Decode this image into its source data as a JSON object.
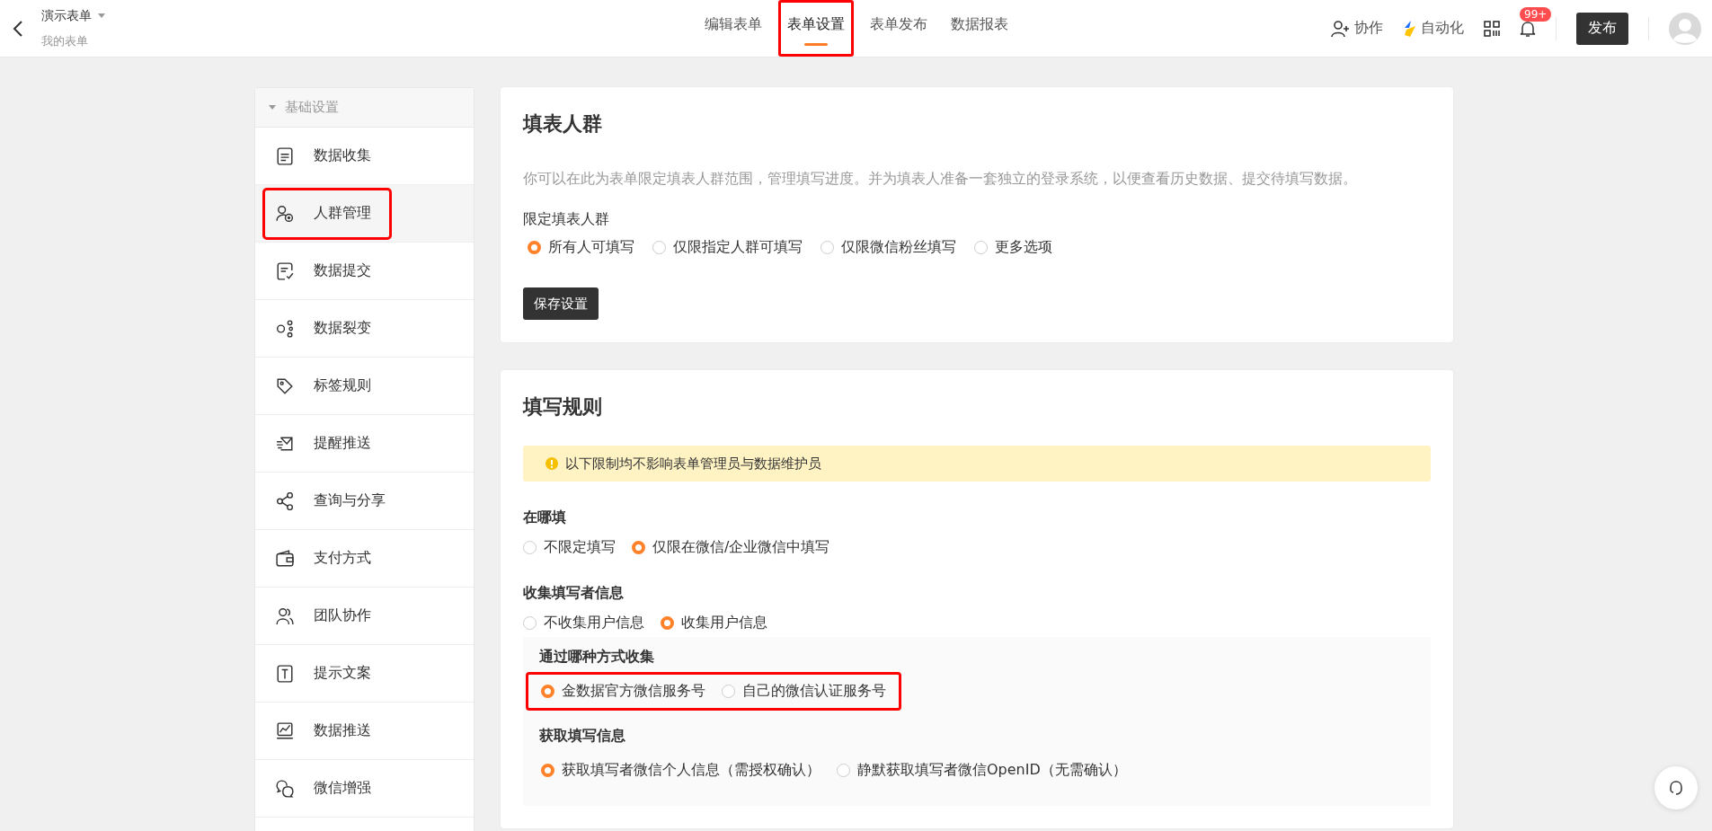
{
  "header": {
    "title": "演示表单",
    "subtitle": "我的表单",
    "tabs": [
      {
        "label": "编辑表单",
        "selected": false,
        "highlighted": false
      },
      {
        "label": "表单设置",
        "selected": true,
        "highlighted": true
      },
      {
        "label": "表单发布",
        "selected": false,
        "highlighted": false
      },
      {
        "label": "数据报表",
        "selected": false,
        "highlighted": false
      }
    ],
    "collaborate": "协作",
    "automation": "自动化",
    "notification_badge": "99+",
    "publish": "发布"
  },
  "sidebar": {
    "group": {
      "label": "基础设置",
      "expanded": true
    },
    "items": [
      {
        "label": "数据收集",
        "selected": false,
        "highlighted": false
      },
      {
        "label": "人群管理",
        "selected": true,
        "highlighted": true
      },
      {
        "label": "数据提交",
        "selected": false,
        "highlighted": false
      },
      {
        "label": "数据裂变",
        "selected": false,
        "highlighted": false
      },
      {
        "label": "标签规则",
        "selected": false,
        "highlighted": false
      },
      {
        "label": "提醒推送",
        "selected": false,
        "highlighted": false
      },
      {
        "label": "查询与分享",
        "selected": false,
        "highlighted": false
      },
      {
        "label": "支付方式",
        "selected": false,
        "highlighted": false
      },
      {
        "label": "团队协作",
        "selected": false,
        "highlighted": false
      },
      {
        "label": "提示文案",
        "selected": false,
        "highlighted": false
      },
      {
        "label": "数据推送",
        "selected": false,
        "highlighted": false
      },
      {
        "label": "微信增强",
        "selected": false,
        "highlighted": false
      }
    ]
  },
  "audience_card": {
    "title": "填表人群",
    "description": "你可以在此为表单限定填表人群范围，管理填写进度。并为填表人准备一套独立的登录系统，以便查看历史数据、提交待填写数据。",
    "field_label": "限定填表人群",
    "options": [
      {
        "label": "所有人可填写",
        "selected": true
      },
      {
        "label": "仅限指定人群可填写",
        "selected": false
      },
      {
        "label": "仅限微信粉丝填写",
        "selected": false
      },
      {
        "label": "更多选项",
        "selected": false
      }
    ],
    "save_button": "保存设置"
  },
  "rules_card": {
    "title": "填写规则",
    "notice": "以下限制均不影响表单管理员与数据维护员",
    "sections": [
      {
        "title": "在哪填",
        "options": [
          {
            "label": "不限定填写",
            "selected": false
          },
          {
            "label": "仅限在微信/企业微信中填写",
            "selected": true
          }
        ]
      },
      {
        "title": "收集填写者信息",
        "options": [
          {
            "label": "不收集用户信息",
            "selected": false
          },
          {
            "label": "收集用户信息",
            "selected": true
          }
        ]
      }
    ],
    "subsections": [
      {
        "title": "通过哪种方式收集",
        "highlighted": true,
        "options": [
          {
            "label": "金数据官方微信服务号",
            "selected": true
          },
          {
            "label": "自己的微信认证服务号",
            "selected": false
          }
        ]
      },
      {
        "title": "获取填写信息",
        "highlighted": false,
        "options": [
          {
            "label": "获取填写者微信个人信息（需授权确认）",
            "selected": true
          },
          {
            "label": "静默获取填写者微信OpenID（无需确认）",
            "selected": false
          }
        ]
      }
    ]
  }
}
